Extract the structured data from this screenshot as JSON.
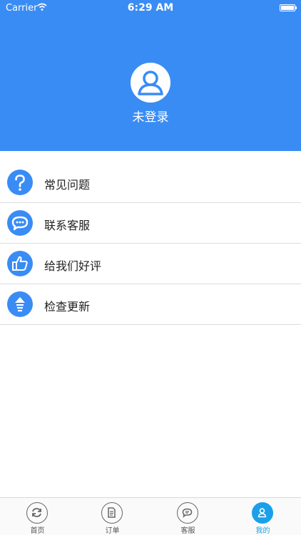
{
  "statusbar": {
    "carrier": "Carrier",
    "time": "6:29 AM"
  },
  "profile": {
    "username": "未登录"
  },
  "menu": {
    "items": [
      {
        "label": "常见问题",
        "icon": "question-icon"
      },
      {
        "label": "联系客服",
        "icon": "chat-icon"
      },
      {
        "label": "给我们好评",
        "icon": "thumbs-up-icon"
      },
      {
        "label": "检查更新",
        "icon": "update-icon"
      }
    ]
  },
  "tabbar": {
    "tabs": [
      {
        "label": "首页",
        "icon": "refresh-icon"
      },
      {
        "label": "订单",
        "icon": "document-icon"
      },
      {
        "label": "客服",
        "icon": "message-icon"
      },
      {
        "label": "我的",
        "icon": "user-icon",
        "active": true
      }
    ]
  },
  "colors": {
    "header": "#3a8cf5",
    "active_tab": "#1aa0ea"
  }
}
